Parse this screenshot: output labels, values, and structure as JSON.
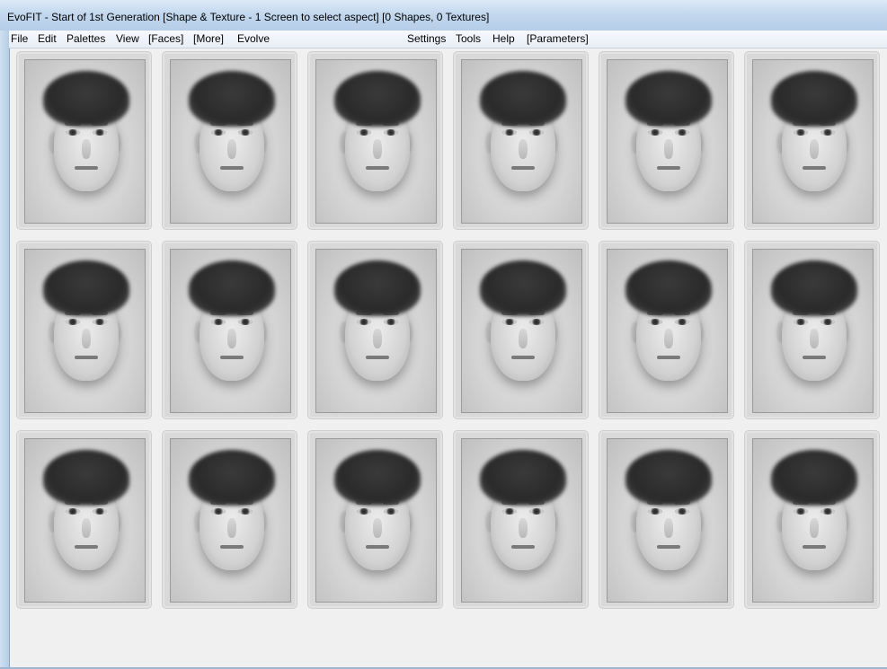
{
  "window": {
    "title": "EvoFIT - Start of 1st Generation [Shape & Texture - 1 Screen to select aspect] [0 Shapes, 0 Textures]"
  },
  "menu": {
    "left": [
      "File",
      "Edit",
      "Palettes",
      "View",
      "[Faces]",
      "[More]",
      "Evolve"
    ],
    "right": [
      "Settings",
      "Tools",
      "Help",
      "[Parameters]"
    ]
  },
  "face_grid": {
    "rows": 3,
    "columns": 6,
    "faces": [
      "face-1",
      "face-2",
      "face-3",
      "face-4",
      "face-5",
      "face-6",
      "face-7",
      "face-8",
      "face-9",
      "face-10",
      "face-11",
      "face-12",
      "face-13",
      "face-14",
      "face-15",
      "face-16",
      "face-17",
      "face-18"
    ]
  }
}
